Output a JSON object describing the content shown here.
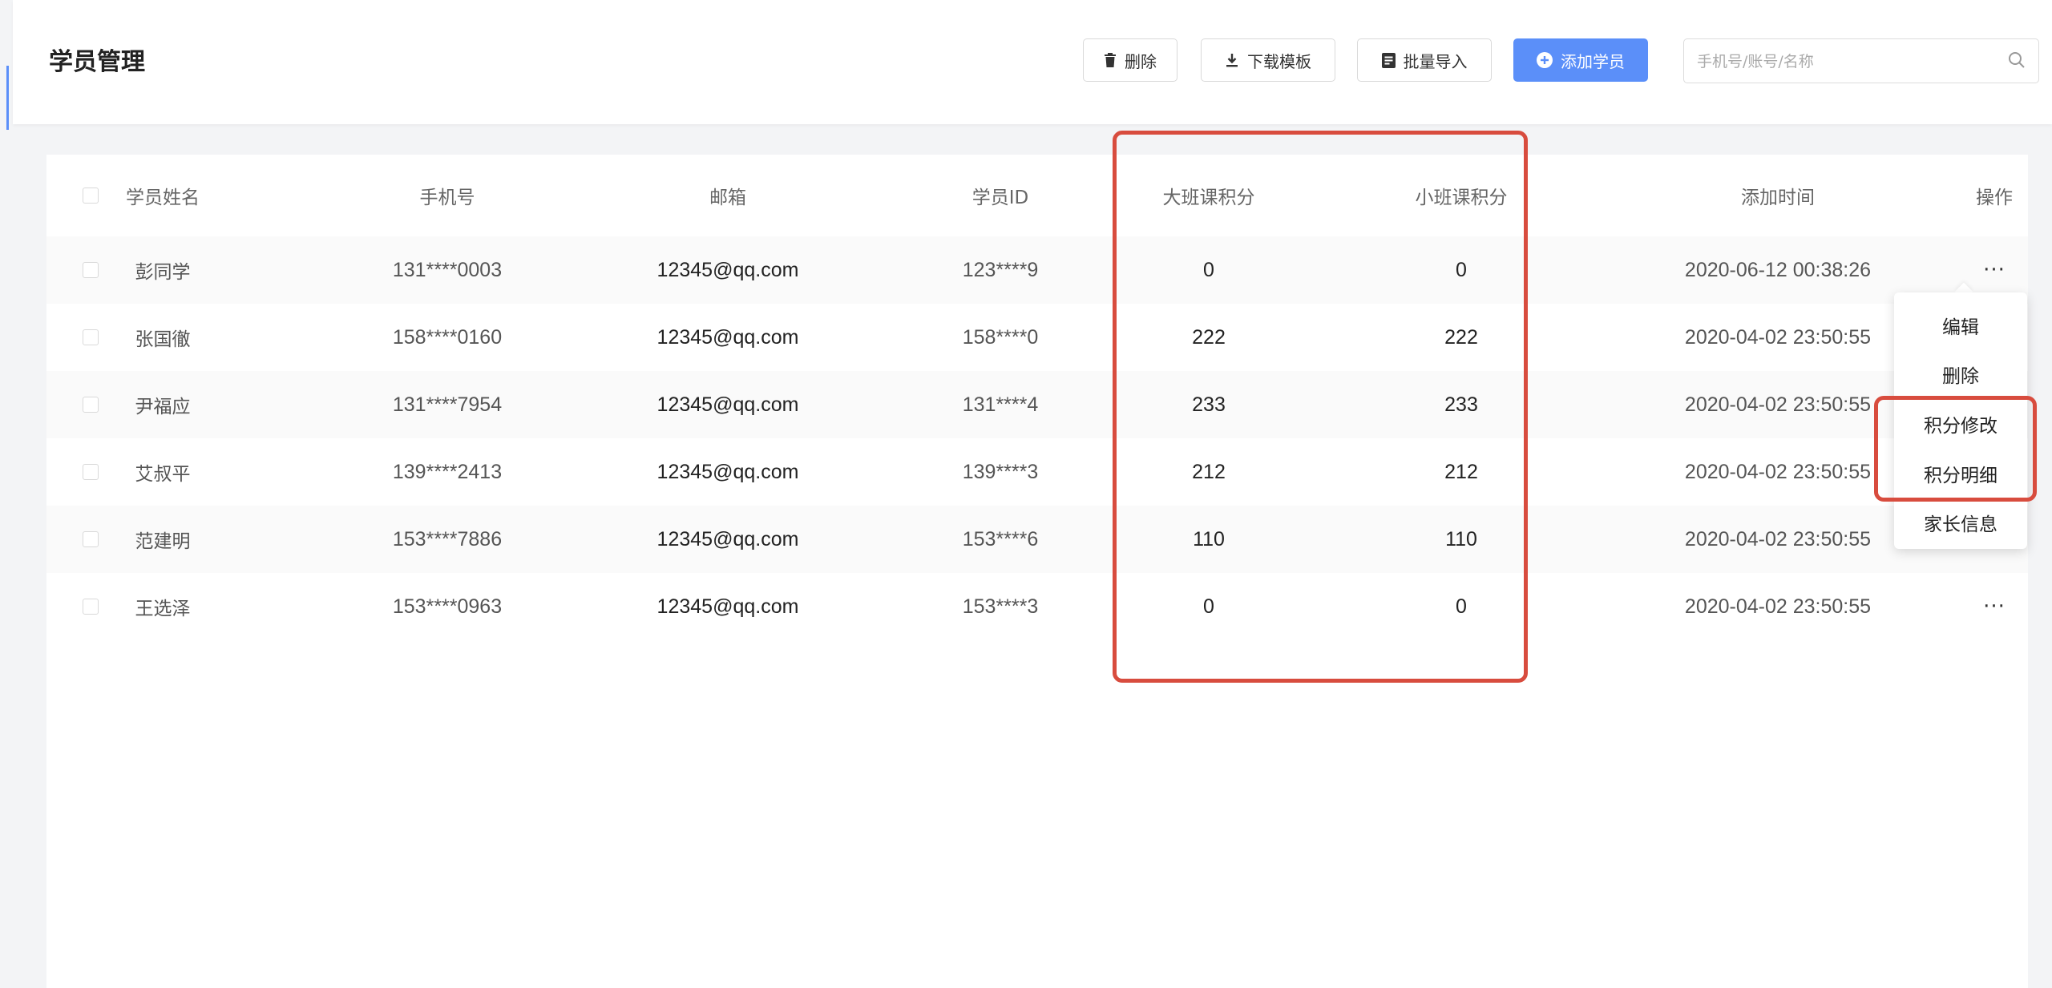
{
  "page": {
    "title": "学员管理"
  },
  "toolbar": {
    "delete_label": "删除",
    "download_template_label": "下载模板",
    "batch_import_label": "批量导入",
    "add_student_label": "添加学员",
    "search_placeholder": "手机号/账号/名称"
  },
  "table": {
    "columns": [
      "学员姓名",
      "手机号",
      "邮箱",
      "学员ID",
      "大班课积分",
      "小班课积分",
      "添加时间",
      "操作"
    ],
    "rows": [
      {
        "name": "彭同学",
        "phone": "131****0003",
        "email": "12345@qq.com",
        "id": "123****9",
        "big_class_points": "0",
        "small_class_points": "0",
        "added": "2020-06-12 00:38:26",
        "action": "···"
      },
      {
        "name": "张国徹",
        "phone": "158****0160",
        "email": "12345@qq.com",
        "id": "158****0",
        "big_class_points": "222",
        "small_class_points": "222",
        "added": "2020-04-02 23:50:55",
        "action": ""
      },
      {
        "name": "尹福应",
        "phone": "131****7954",
        "email": "12345@qq.com",
        "id": "131****4",
        "big_class_points": "233",
        "small_class_points": "233",
        "added": "2020-04-02 23:50:55",
        "action": ""
      },
      {
        "name": "艾叔平",
        "phone": "139****2413",
        "email": "12345@qq.com",
        "id": "139****3",
        "big_class_points": "212",
        "small_class_points": "212",
        "added": "2020-04-02 23:50:55",
        "action": ""
      },
      {
        "name": "范建明",
        "phone": "153****7886",
        "email": "12345@qq.com",
        "id": "153****6",
        "big_class_points": "110",
        "small_class_points": "110",
        "added": "2020-04-02 23:50:55",
        "action": ""
      },
      {
        "name": "王选泽",
        "phone": "153****0963",
        "email": "12345@qq.com",
        "id": "153****3",
        "big_class_points": "0",
        "small_class_points": "0",
        "added": "2020-04-02 23:50:55",
        "action": "···"
      }
    ]
  },
  "action_menu": {
    "items": [
      "编辑",
      "删除",
      "积分修改",
      "积分明细",
      "家长信息"
    ]
  },
  "colors": {
    "primary": "#5b8ff9",
    "highlight": "#d84c3e"
  }
}
